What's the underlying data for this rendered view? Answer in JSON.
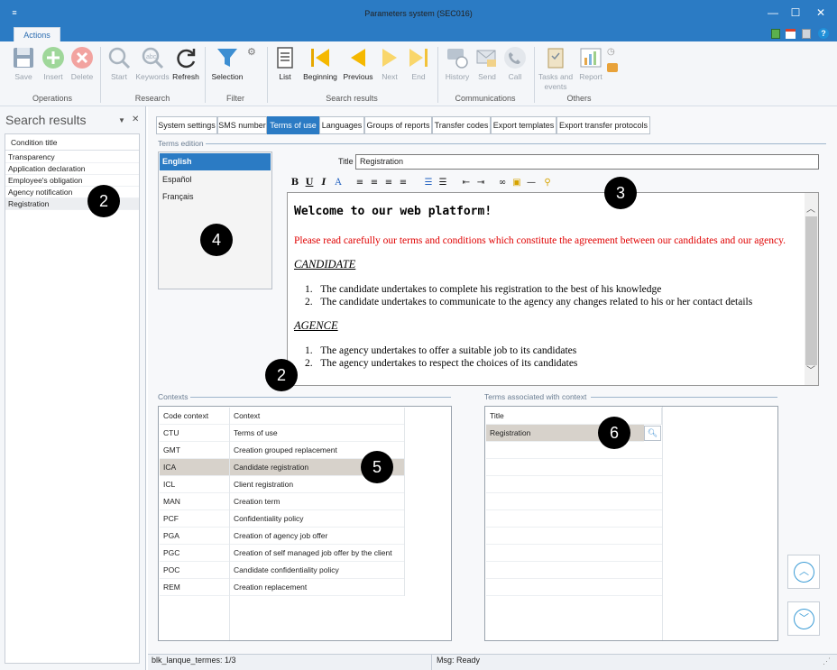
{
  "window": {
    "title": "Parameters system (SEC016)",
    "tab": "Actions"
  },
  "ribbon": {
    "buttons": {
      "save": "Save",
      "insert": "Insert",
      "delete": "Delete",
      "start": "Start",
      "keywords": "Keywords",
      "refresh": "Refresh",
      "selection": "Selection",
      "list": "List",
      "beginning": "Beginning",
      "previous": "Previous",
      "next": "Next",
      "end": "End",
      "history": "History",
      "send": "Send",
      "call": "Call",
      "tasks_line1": "Tasks and",
      "tasks_line2": "events",
      "report": "Report"
    },
    "groups": {
      "operations": "Operations",
      "research": "Research",
      "filter": "Filter",
      "search_results": "Search results",
      "communications": "Communications",
      "others": "Others"
    }
  },
  "search_pane": {
    "title": "Search results",
    "column": "Condition title",
    "items": [
      "Transparency",
      "Application declaration",
      "Employee's obligation",
      "Agency notification",
      "Registration"
    ]
  },
  "tabs": [
    "System settings",
    "SMS number",
    "Terms of use",
    "Languages",
    "Groups of reports",
    "Transfer codes",
    "Export templates",
    "Export transfer protocols"
  ],
  "terms": {
    "legend": "Terms edition",
    "languages": [
      "English",
      "Español",
      "Français"
    ],
    "title_label": "Title",
    "title_value": "Registration",
    "editor": {
      "heading": "Welcome to our web platform!",
      "intro": "Please read carefully our terms and conditions which constitute the agreement between our candidates and our agency.",
      "section1": "CANDIDATE",
      "items1": [
        "The candidate undertakes to complete his registration to the best of his knowledge",
        "The candidate undertakes to communicate to the agency any changes related to his or her contact details"
      ],
      "section2": "AGENCE",
      "items2": [
        "The agency undertakes to offer a suitable job to its candidates",
        "The agency undertakes to respect the choices of its candidates"
      ]
    }
  },
  "contexts": {
    "legend": "Contexts",
    "headers": [
      "Code context",
      "Context"
    ],
    "rows": [
      [
        "CTU",
        "Terms of use"
      ],
      [
        "GMT",
        "Creation grouped replacement"
      ],
      [
        "ICA",
        "Candidate registration"
      ],
      [
        "ICL",
        "Client registration"
      ],
      [
        "MAN",
        "Creation term"
      ],
      [
        "PCF",
        "Confidentiality policy"
      ],
      [
        "PGA",
        "Creation of agency job offer"
      ],
      [
        "PGC",
        "Creation of self managed job offer by the client"
      ],
      [
        "POC",
        "Candidate confidentiality policy"
      ],
      [
        "REM",
        "Creation replacement"
      ]
    ]
  },
  "assoc": {
    "legend": "Terms associated with context",
    "header": "Title",
    "rows": [
      "Registration"
    ]
  },
  "status": {
    "left": "blk_lanque_termes: 1/3",
    "right": "Msg: Ready"
  },
  "callouts": [
    "2",
    "2",
    "3",
    "4",
    "5",
    "6"
  ],
  "colors": {
    "accent": "#2b7bc4",
    "intro_text": "#e00000",
    "selected_row": "#d7d2cb"
  }
}
